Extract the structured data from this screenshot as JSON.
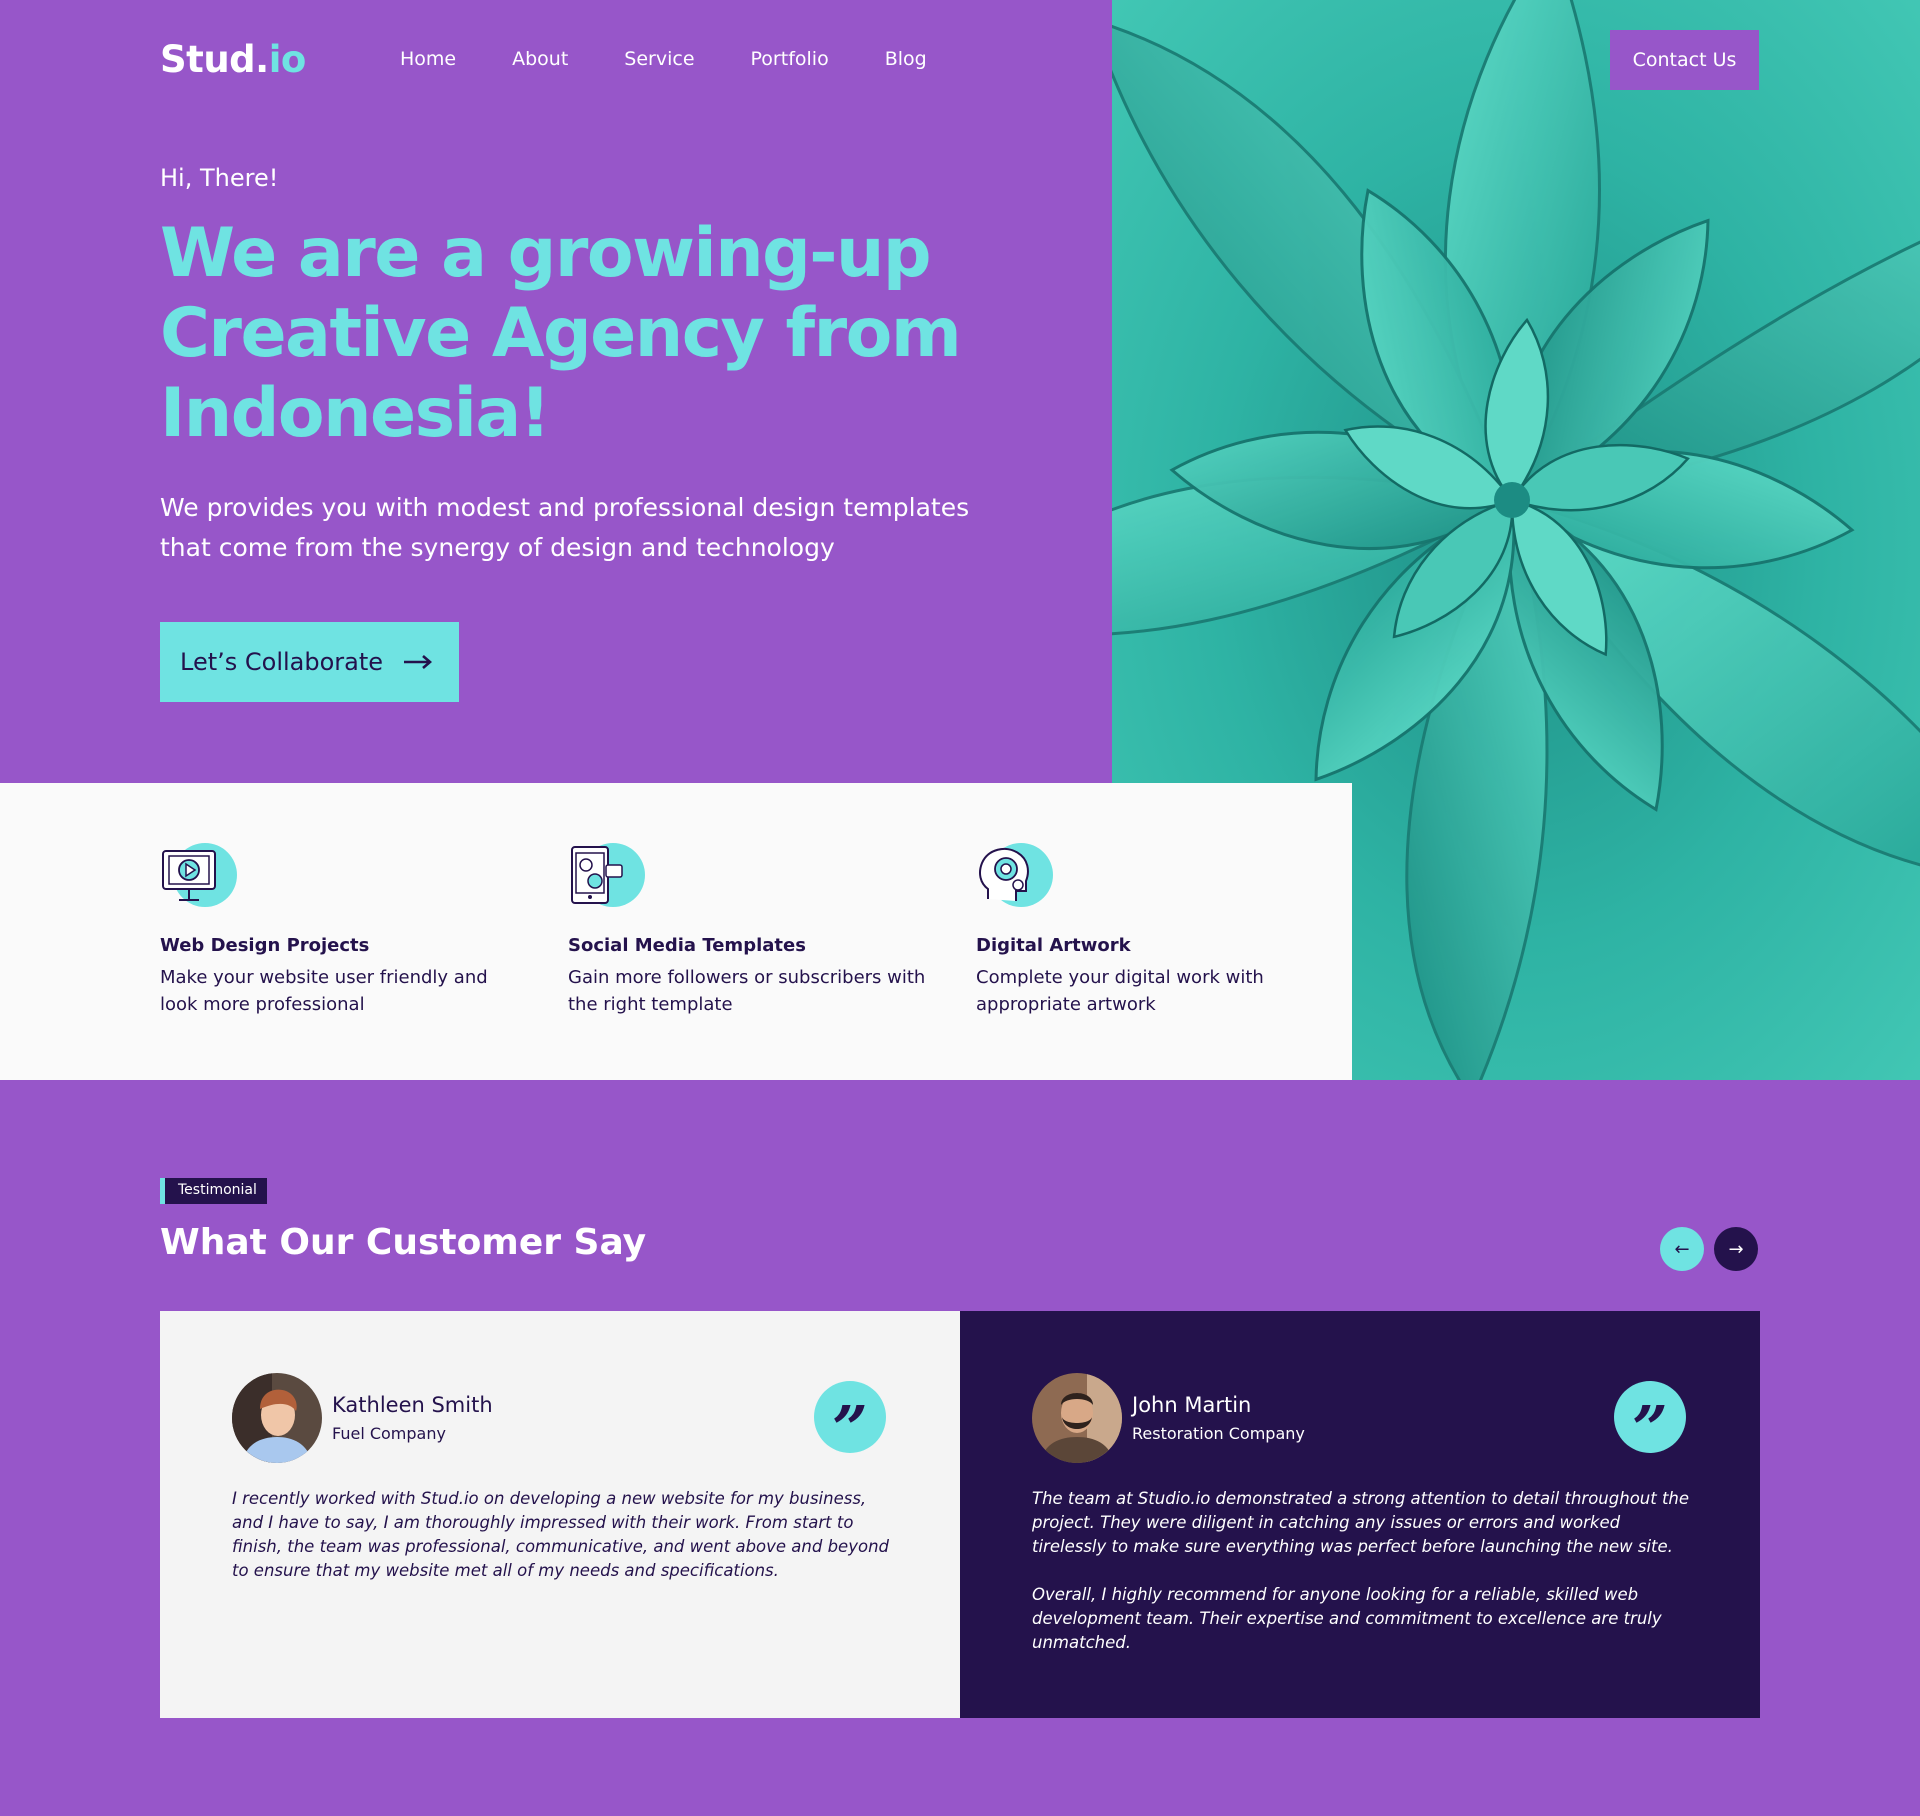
{
  "brand": {
    "part1": "Stud.",
    "part2": "io"
  },
  "nav": {
    "items": [
      "Home",
      "About",
      "Service",
      "Portfolio",
      "Blog"
    ],
    "contact_label": "Contact Us"
  },
  "hero": {
    "greeting": "Hi, There!",
    "headline": "We are a growing-up Creative Agency from Indonesia!",
    "subtext": "We provides you with modest and professional design templates that come from the synergy of design and technology",
    "cta_label": "Let’s Collaborate",
    "cta_arrow": "⟶"
  },
  "services": [
    {
      "icon": "monitor-play-icon",
      "title": "Web Design Projects",
      "description": "Make your website user friendly and look more professional"
    },
    {
      "icon": "phone-social-icon",
      "title": "Social Media Templates",
      "description": "Gain more followers or subscribers with the right template"
    },
    {
      "icon": "head-gear-icon",
      "title": "Digital Artwork",
      "description": "Complete your digital work with appropriate artwork"
    }
  ],
  "testimonial": {
    "tag": "Testimonial",
    "title": "What Our Customer Say",
    "prev_icon": "←",
    "next_icon": "→",
    "quote_mark": "”",
    "cards": [
      {
        "name": "Kathleen Smith",
        "company": "Fuel Company",
        "paragraphs": [
          "I recently worked with Stud.io on developing a new website for my business, and I have to say, I am thoroughly impressed with their work. From start to finish, the team was professional, communicative, and went above and beyond to ensure that my website met all of my needs and specifications."
        ]
      },
      {
        "name": "John Martin",
        "company": "Restoration Company",
        "paragraphs": [
          "The team at Studio.io demonstrated a strong attention to detail throughout the project. They were diligent in catching any issues or errors and worked tirelessly to make sure everything was perfect before launching the new site.",
          "Overall, I highly recommend for anyone looking for a reliable, skilled web development team. Their expertise and commitment to excellence are truly unmatched."
        ]
      }
    ]
  },
  "colors": {
    "purple": "#9756C9",
    "cyan": "#6FE3E2",
    "navy": "#24124C",
    "light": "#FAFAFA",
    "card_light": "#F4F4F4"
  }
}
